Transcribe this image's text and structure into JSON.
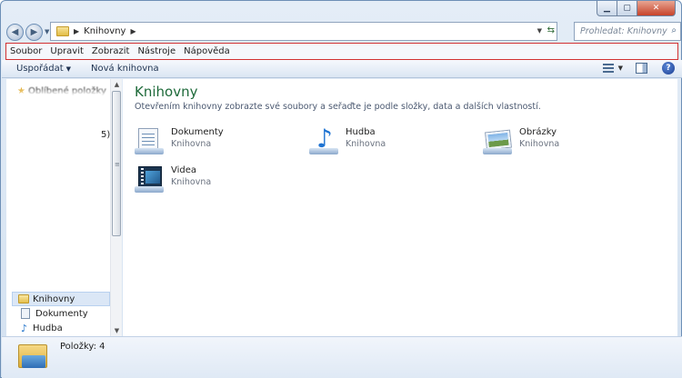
{
  "window": {
    "caption": {
      "minimize": "▁",
      "maximize": "▢",
      "close": "✕"
    }
  },
  "nav": {
    "back_icon": "back-arrow-icon",
    "forward_icon": "forward-arrow-icon",
    "breadcrumb": [
      "Knihovny"
    ],
    "search_placeholder": "Prohledat: Knihovny"
  },
  "menu": {
    "items": [
      "Soubor",
      "Upravit",
      "Zobrazit",
      "Nástroje",
      "Nápověda"
    ]
  },
  "toolbar": {
    "organize_label": "Uspořádat",
    "new_library_label": "Nová knihovna"
  },
  "sidebar": {
    "favorites_label": "Oblíbené položky",
    "stray_text": "5)",
    "libraries_label": "Knihovny",
    "sub_items": [
      "Dokumenty",
      "Hudba"
    ]
  },
  "content": {
    "title": "Knihovny",
    "description": "Otevřením knihovny zobrazte své soubory a seřaďte je podle složky, data a dalších vlastností.",
    "libraries": [
      {
        "name": "Dokumenty",
        "type": "Knihovna",
        "icon": "documents-library-icon"
      },
      {
        "name": "Hudba",
        "type": "Knihovna",
        "icon": "music-library-icon"
      },
      {
        "name": "Obrázky",
        "type": "Knihovna",
        "icon": "pictures-library-icon"
      },
      {
        "name": "Videa",
        "type": "Knihovna",
        "icon": "videos-library-icon"
      }
    ]
  },
  "status": {
    "items_count": "Položky: 4"
  },
  "colors": {
    "title_green": "#1e6a3a",
    "menubar_highlight": "#d23232",
    "selection": "#dbe7f6"
  }
}
